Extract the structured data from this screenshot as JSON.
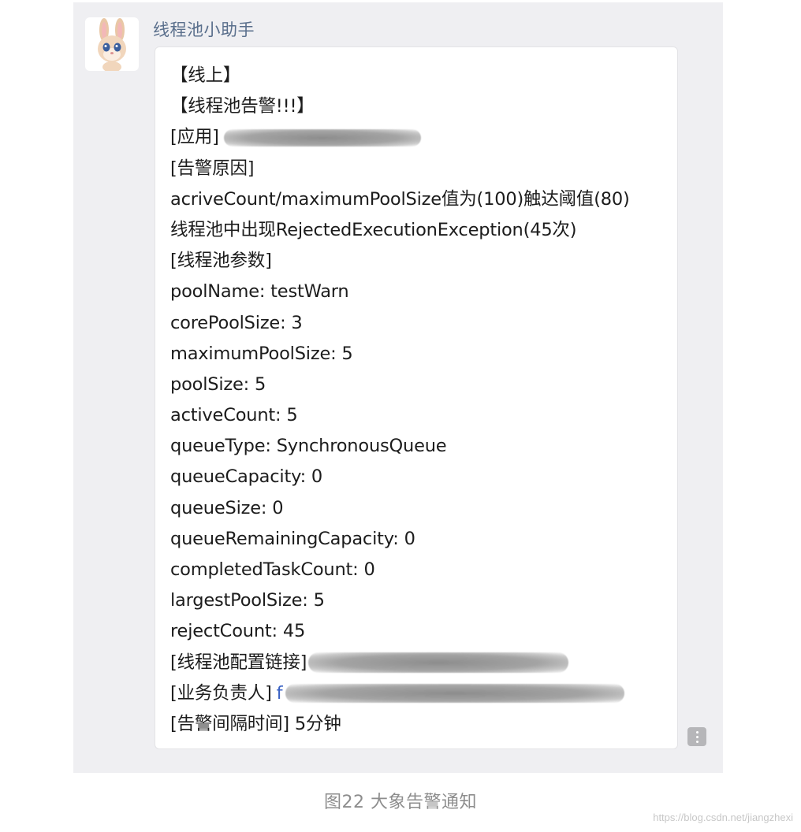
{
  "chat": {
    "sender_name": "线程池小助手",
    "avatar_icon": "rabbit-avatar-icon",
    "message_lines": [
      "【线上】",
      "【线程池告警!!!】",
      "[应用]",
      "[告警原因]",
      "acriveCount/maximumPoolSize值为(100)触达阈值(80)",
      "线程池中出现RejectedExecutionException(45次)",
      "[线程池参数]",
      "poolName: testWarn",
      "corePoolSize: 3",
      "maximumPoolSize: 5",
      "poolSize: 5",
      "activeCount: 5",
      "queueType: SynchronousQueue",
      "queueCapacity: 0",
      "queueSize: 0",
      "queueRemainingCapacity: 0",
      "completedTaskCount: 0",
      "largestPoolSize: 5",
      "rejectCount: 45",
      "[线程池配置链接]",
      "[业务负责人]",
      "[告警间隔时间] 5分钟"
    ],
    "owner_link_fragment": "f",
    "more_icon": "more-vertical-icon"
  },
  "caption": "图22 大象告警通知",
  "watermark": "https://blog.csdn.net/jiangzhexi",
  "colors": {
    "panel_bg": "#efeff2",
    "sender_name": "#5a6f8c",
    "link": "#3a62c4",
    "caption": "#8d8d8d"
  }
}
